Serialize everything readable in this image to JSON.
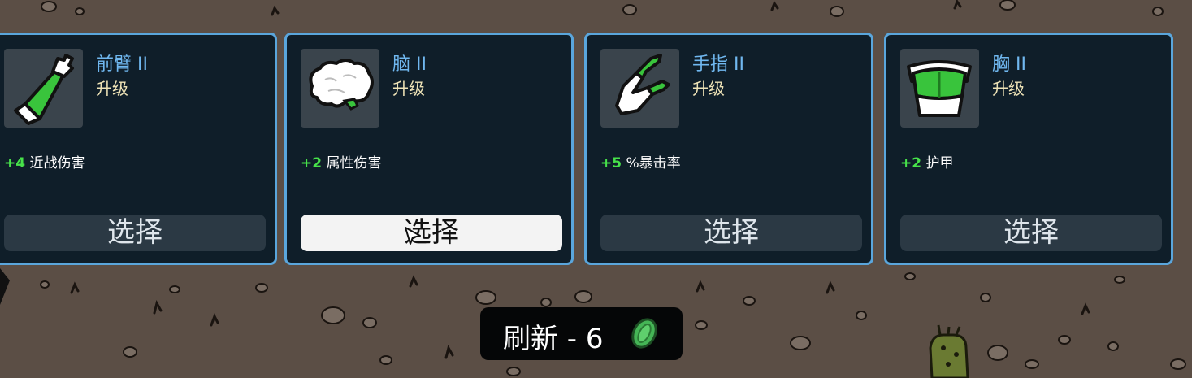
{
  "cards": [
    {
      "name": "前臂 II",
      "type": "升级",
      "stat_value": "+4",
      "stat_label": "近战伤害",
      "button": "选择",
      "icon": "forearm-icon"
    },
    {
      "name": "脑 II",
      "type": "升级",
      "stat_value": "+2",
      "stat_label": "属性伤害",
      "button": "选择",
      "icon": "brain-icon"
    },
    {
      "name": "手指 II",
      "type": "升级",
      "stat_value": "+5",
      "stat_label": "%暴击率",
      "button": "选择",
      "icon": "finger-icon"
    },
    {
      "name": "胸 II",
      "type": "升级",
      "stat_value": "+2",
      "stat_label": "护甲",
      "button": "选择",
      "icon": "chest-icon"
    }
  ],
  "refresh": {
    "label": "刷新 - 6",
    "icon": "material-coin-icon"
  },
  "colors": {
    "card_bg": "#0f1e29",
    "card_border": "#5aa6dc",
    "item_name": "#70b8f0",
    "item_type": "#ede2b6",
    "stat_positive": "#47e24a",
    "button_bg": "#2b3944",
    "button_active": "#f3f3f3",
    "ground": "#5b4e45",
    "coin": "#45b556"
  }
}
